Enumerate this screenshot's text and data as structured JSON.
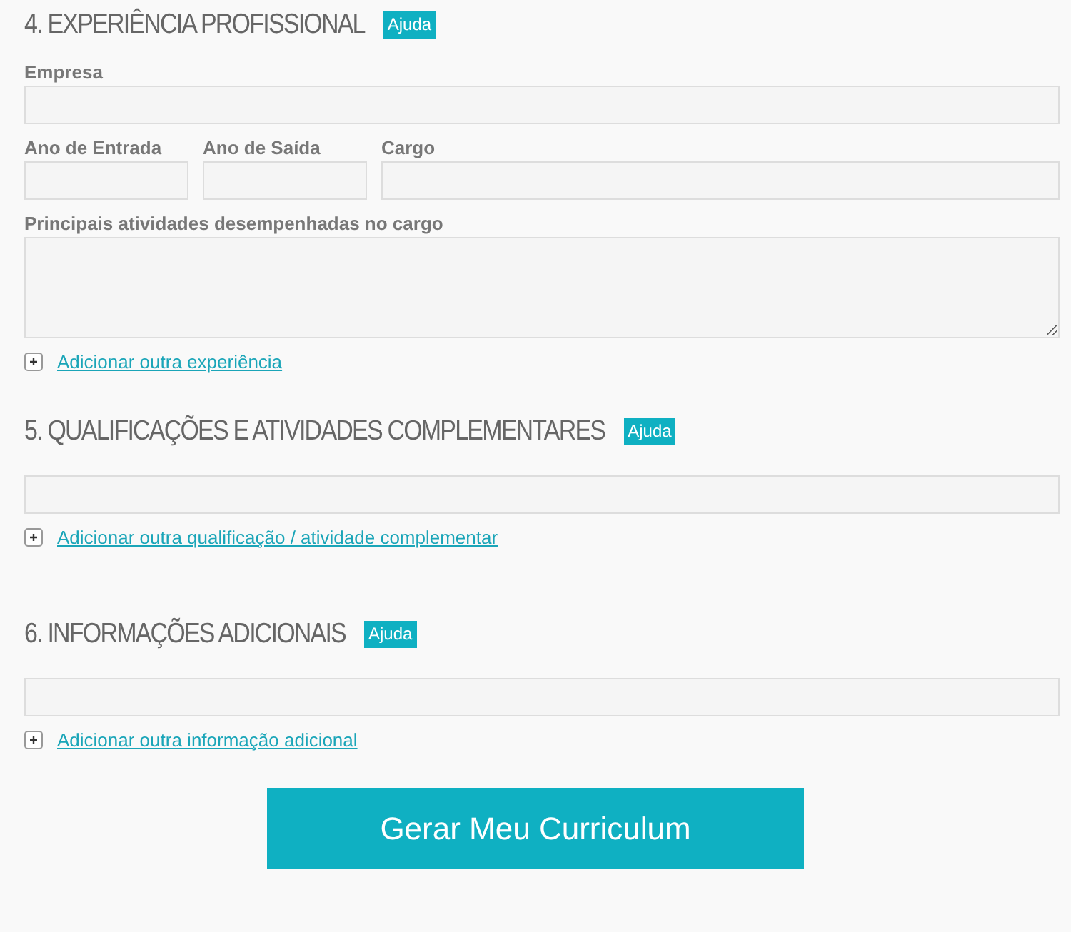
{
  "sections": [
    {
      "heading": "4. EXPERIÊNCIA PROFISSIONAL",
      "help": "Ajuda",
      "rows": [
        [
          {
            "label": "Empresa",
            "kind": "input"
          }
        ],
        [
          {
            "label": "Ano de Entrada",
            "kind": "short_input"
          },
          {
            "label": "Ano de Saída",
            "kind": "short_input"
          },
          {
            "label": "Cargo",
            "kind": "input"
          }
        ],
        [
          {
            "label": "Principais atividades desempenhadas no cargo",
            "kind": "textarea"
          }
        ]
      ],
      "add_link": "Adicionar outra experiência"
    },
    {
      "heading": "5. QUALIFICAÇÕES E ATIVIDADES COMPLEMENTARES",
      "help": "Ajuda",
      "rows": [
        [
          {
            "kind": "input"
          }
        ]
      ],
      "add_link": "Adicionar outra qualificação / atividade complementar"
    },
    {
      "heading": "6. INFORMAÇÕES ADICIONAIS",
      "help": "Ajuda",
      "rows": [
        [
          {
            "kind": "input"
          }
        ]
      ],
      "add_link": "Adicionar outra informação adicional"
    }
  ],
  "submit_button": "Gerar Meu Curriculum"
}
